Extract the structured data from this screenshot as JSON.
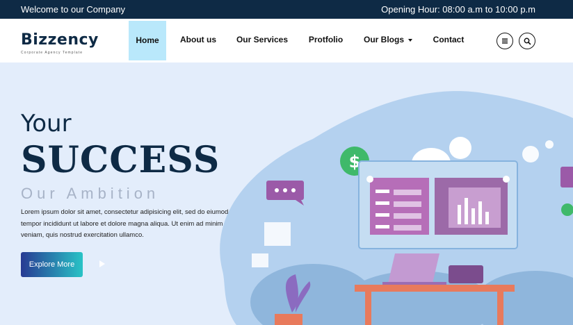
{
  "topbar": {
    "welcome": "Welcome to our Company",
    "hours": "Opening Hour: 08:00 a.m to 10:00 p.m"
  },
  "logo": {
    "name": "Bizzency",
    "tagline": "Corporate Agency Template"
  },
  "nav": {
    "items": [
      {
        "label": "Home",
        "active": true
      },
      {
        "label": "About us"
      },
      {
        "label": "Our Services"
      },
      {
        "label": "Protfolio"
      },
      {
        "label": "Our Blogs",
        "dropdown": true
      },
      {
        "label": "Contact"
      }
    ],
    "menu_icon": "menu-icon",
    "search_icon": "search-icon"
  },
  "hero": {
    "line1": "Your",
    "line2": "SUCCESS",
    "line3": "Our Ambition",
    "description": "Lorem ipsum dolor sit amet, consectetur adipisicing elit, sed do eiumod tempor incididunt ut labore et dolore magna aliqua. Ut enim ad minim veniam, quis nostrud exercitation ullamco.",
    "button": "Explore More",
    "play_icon": "play-icon"
  },
  "colors": {
    "topbar": "#0e2a45",
    "nav_active": "#b9e8fb",
    "hero_bg": "#e3edfb",
    "button_start": "#283a93",
    "button_end": "#29c3c6"
  }
}
